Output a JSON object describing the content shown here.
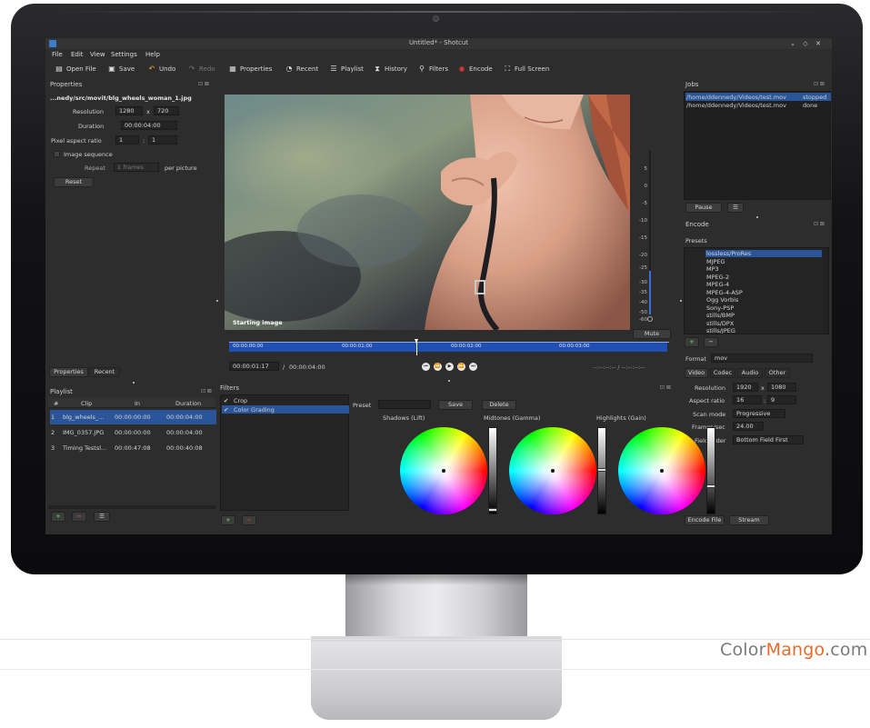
{
  "window": {
    "title": "Untitled* - Shotcut"
  },
  "menu": [
    "File",
    "Edit",
    "View",
    "Settings",
    "Help"
  ],
  "toolbar": [
    {
      "label": "Open File",
      "icon": "open-file-icon",
      "enabled": true
    },
    {
      "label": "Save",
      "icon": "save-icon",
      "enabled": true
    },
    {
      "label": "Undo",
      "icon": "undo-icon",
      "enabled": true
    },
    {
      "label": "Redo",
      "icon": "redo-icon",
      "enabled": false
    },
    {
      "label": "Properties",
      "icon": "properties-icon",
      "enabled": true
    },
    {
      "label": "Recent",
      "icon": "recent-icon",
      "enabled": true
    },
    {
      "label": "Playlist",
      "icon": "playlist-icon",
      "enabled": true
    },
    {
      "label": "History",
      "icon": "history-icon",
      "enabled": true
    },
    {
      "label": "Filters",
      "icon": "filters-icon",
      "enabled": true
    },
    {
      "label": "Encode",
      "icon": "encode-icon",
      "enabled": true
    },
    {
      "label": "Full Screen",
      "icon": "fullscreen-icon",
      "enabled": true
    }
  ],
  "properties": {
    "title": "Properties",
    "filename": "...nedy/src/movit/blg_wheels_woman_1.jpg",
    "resolution_label": "Resolution",
    "resolution_w": "1280",
    "resolution_x": "x",
    "resolution_h": "720",
    "duration_label": "Duration",
    "duration": "00:00:04:00",
    "par_label": "Pixel aspect ratio",
    "par_num": "1",
    "par_sep": ":",
    "par_den": "1",
    "image_sequence": "Image sequence",
    "repeat_label": "Repeat",
    "repeat_value": "1 frames",
    "per_picture": "per picture",
    "reset": "Reset",
    "tabs": [
      "Properties",
      "Recent"
    ]
  },
  "player": {
    "overlay": "Starting image",
    "mute": "Mute",
    "scale": [
      "5",
      "0",
      "-5",
      "-10",
      "-15",
      "-20",
      "-25",
      "-30",
      "-35",
      "-40",
      "-50",
      "-60"
    ],
    "ticks": [
      "00:00:00:00",
      "00:00:01:00",
      "00:00:02:00",
      "00:00:03:00"
    ],
    "position": "00:00:01:17",
    "separator": "/",
    "total": "00:00:04:00",
    "in_out": "--:--:--:-- / --:--:--:--"
  },
  "jobs": {
    "title": "Jobs",
    "rows": [
      {
        "path": "/home/ddennedy/Videos/test.mov",
        "status": "stopped"
      },
      {
        "path": "/home/ddennedy/Videos/test.mov",
        "status": "done"
      }
    ],
    "pause": "Pause"
  },
  "encode": {
    "title": "Encode",
    "presets_label": "Presets",
    "presets": [
      "lossless/ProRes",
      "MJPEG",
      "MP3",
      "MPEG-2",
      "MPEG-4",
      "MPEG-4-ASP",
      "Ogg Vorbis",
      "Sony-PSP",
      "stills/BMP",
      "stills/DPX",
      "stills/JPEG"
    ],
    "format_label": "Format",
    "format_value": "mov",
    "tabs": [
      "Video",
      "Codec",
      "Audio",
      "Other"
    ],
    "resolution_label": "Resolution",
    "res_w": "1920",
    "res_x": "x",
    "res_h": "1080",
    "aspect_label": "Aspect ratio",
    "aspect_num": "16",
    "aspect_sep": ":",
    "aspect_den": "9",
    "scan_label": "Scan mode",
    "scan_value": "Progressive",
    "fps_label": "Frames/sec",
    "fps_value": "24.00",
    "field_label": "Field order",
    "field_value": "Bottom Field First",
    "encode_file": "Encode File",
    "stream": "Stream"
  },
  "playlist": {
    "title": "Playlist",
    "columns": [
      "#",
      "Clip",
      "In",
      "Duration"
    ],
    "rows": [
      {
        "num": "1",
        "clip": "blg_wheels_...",
        "in": "00:00:00:00",
        "duration": "00:00:04:00"
      },
      {
        "num": "2",
        "clip": "IMG_0357.JPG",
        "in": "00:00:00:00",
        "duration": "00:00:04:00"
      },
      {
        "num": "3",
        "clip": "Timing Testsl...",
        "in": "00:00:47:08",
        "duration": "00:00:40:08"
      }
    ]
  },
  "filters": {
    "title": "Filters",
    "items": [
      "Crop",
      "Color Grading"
    ],
    "preset_label": "Preset",
    "save": "Save",
    "delete": "Delete",
    "wheels": [
      {
        "label": "Shadows (Lift)",
        "level": 0.0
      },
      {
        "label": "Midtones (Gamma)",
        "level": 0.5
      },
      {
        "label": "Highlights (Gain)",
        "level": 0.3
      }
    ]
  },
  "watermark": {
    "color": "Color",
    "mango": "Mango",
    "com": ".com"
  },
  "colors": {
    "accent": "#1f4fb3",
    "selection": "#2a5599",
    "bg": "#2d2d2d",
    "add": "#3aa53a",
    "remove": "#c83232"
  }
}
